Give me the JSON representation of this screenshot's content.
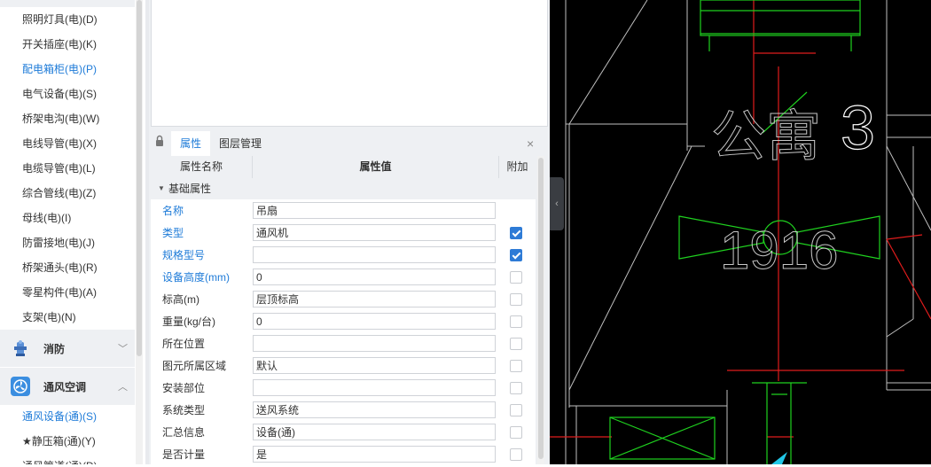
{
  "left_tree": {
    "items": [
      {
        "label": "照明灯具(电)(D)",
        "active": false
      },
      {
        "label": "开关插座(电)(K)",
        "active": false
      },
      {
        "label": "配电箱柜(电)(P)",
        "active": true
      },
      {
        "label": "电气设备(电)(S)",
        "active": false
      },
      {
        "label": "桥架电沟(电)(W)",
        "active": false
      },
      {
        "label": "电线导管(电)(X)",
        "active": false
      },
      {
        "label": "电缆导管(电)(L)",
        "active": false
      },
      {
        "label": "综合管线(电)(Z)",
        "active": false
      },
      {
        "label": "母线(电)(I)",
        "active": false
      },
      {
        "label": "防雷接地(电)(J)",
        "active": false
      },
      {
        "label": "桥架通头(电)(R)",
        "active": false
      },
      {
        "label": "零星构件(电)(A)",
        "active": false
      },
      {
        "label": "支架(电)(N)",
        "active": false
      }
    ],
    "groups": [
      {
        "label": "消防",
        "icon": "fire-hydrant-icon",
        "chevron": "﹀"
      },
      {
        "label": "通风空调",
        "icon": "fan-icon",
        "chevron": "︿"
      }
    ],
    "sub_items": [
      {
        "label": "通风设备(通)(S)",
        "active": true
      },
      {
        "label": "★静压箱(通)(Y)",
        "active": false
      },
      {
        "label": "通风管道(通)(D)",
        "active": false
      }
    ]
  },
  "panel": {
    "tabs": [
      "属性",
      "图层管理"
    ],
    "active_tab": "属性",
    "close_label": "×"
  },
  "table": {
    "headers": [
      "属性名称",
      "属性值",
      "附加"
    ],
    "section": "基础属性",
    "rows": [
      {
        "name": "名称",
        "value": "吊扇",
        "blue": true,
        "checkbox": null
      },
      {
        "name": "类型",
        "value": "通风机",
        "blue": true,
        "checkbox": true
      },
      {
        "name": "规格型号",
        "value": "",
        "blue": true,
        "checkbox": true
      },
      {
        "name": "设备高度(mm)",
        "value": "0",
        "blue": true,
        "checkbox": false
      },
      {
        "name": "标高(m)",
        "value": "层顶标高",
        "blue": false,
        "checkbox": false
      },
      {
        "name": "重量(kg/台)",
        "value": "0",
        "blue": false,
        "checkbox": false
      },
      {
        "name": "所在位置",
        "value": "",
        "blue": false,
        "checkbox": false
      },
      {
        "name": "图元所属区域",
        "value": "默认",
        "blue": false,
        "checkbox": false
      },
      {
        "name": "安装部位",
        "value": "",
        "blue": false,
        "checkbox": false
      },
      {
        "name": "系统类型",
        "value": "送风系统",
        "blue": false,
        "checkbox": false
      },
      {
        "name": "汇总信息",
        "value": "设备(通)",
        "blue": false,
        "checkbox": false
      },
      {
        "name": "是否计量",
        "value": "是",
        "blue": false,
        "checkbox": false
      }
    ]
  },
  "cad": {
    "room_label": "公寓",
    "room_number": "3",
    "dimension_text": "1916",
    "colors": {
      "line": "#bfbfbf",
      "green": "#1fd11f",
      "red": "#e01c1c",
      "cyan": "#22c8e8"
    }
  },
  "colors": {
    "accent": "#1e7bd8",
    "panel_bg": "#eef0f3",
    "checkbox_on": "#2e7bd6"
  }
}
